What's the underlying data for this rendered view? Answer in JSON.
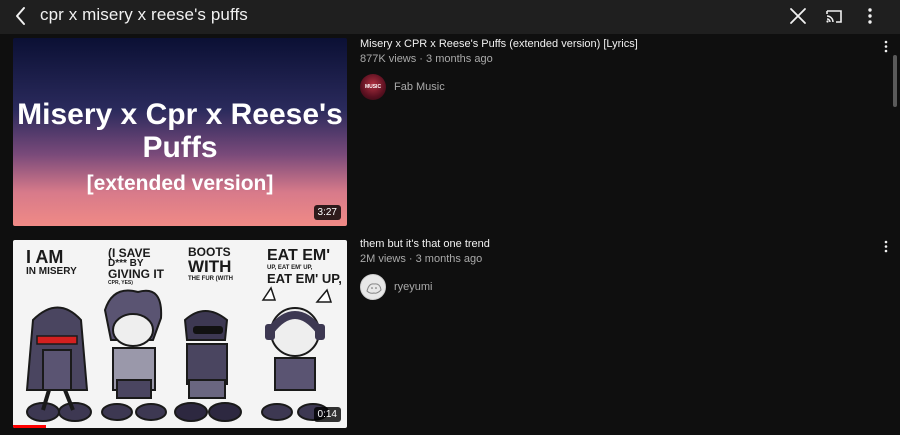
{
  "search": {
    "query": "cpr x misery x reese's puffs"
  },
  "icons": {
    "back": "chevron-left-icon",
    "clear": "close-icon",
    "cast": "cast-icon",
    "menu": "more-vert-icon"
  },
  "results": [
    {
      "title": "Misery x CPR x Reese's Puffs (extended version) [Lyrics]",
      "meta": "877K views · 3 months ago",
      "channel": "Fab Music",
      "duration": "3:27",
      "thumb_text": {
        "line1": "Misery x Cpr x Reese's",
        "line2": "Puffs",
        "line3": "[extended version]"
      },
      "avatar_text": "MUSIC"
    },
    {
      "title": "them but it's that one trend",
      "meta": "2M views · 3 months ago",
      "channel": "ryeyumi",
      "duration": "0:14",
      "progress": 0.1,
      "thumb_text": {
        "c1a": "I AM",
        "c1b": "IN MISERY",
        "c2a": "(I SAVE",
        "c2b": "D*** BY",
        "c2c": "GIVING IT",
        "c2d": "CPR, YES)",
        "c3a": "BOOTS",
        "c3b": "WITH",
        "c3c": "THE FUR (WITH",
        "c4a": "EAT EM'",
        "c4b": "UP, EAT EM' UP,",
        "c4c": "EAT EM' UP,"
      }
    }
  ],
  "colors": {
    "background": "#0f0f0f",
    "topbar": "#1f1f1f",
    "secondary_text": "#aaaaaa",
    "progress": "#ff0000"
  }
}
